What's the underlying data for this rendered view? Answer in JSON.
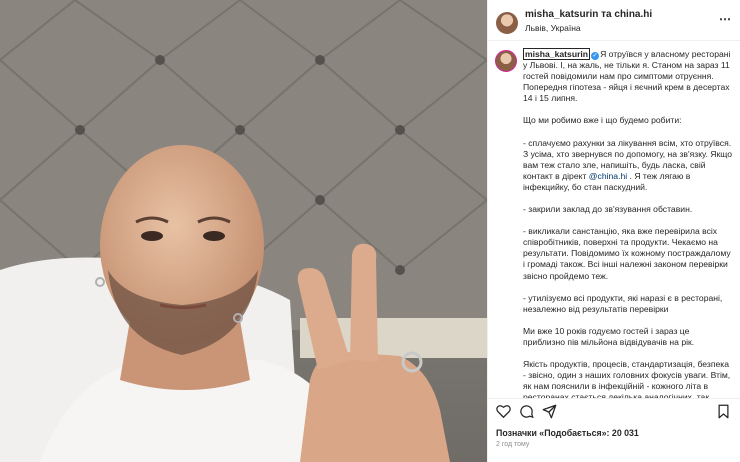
{
  "post": {
    "header": {
      "names": "misha_katsurin та china.hi",
      "location": "Львів, Україна",
      "more_icon": "⋯"
    },
    "caption": {
      "username": "misha_katsurin",
      "first_paragraph": "Я отруївся у власному ресторані у Львові. І, на жаль, не тільки я. Станом на зараз 11 гостей повідомили нам про симптоми отруєння. Попередня гіпотеза - яйця і яєчний крем в десертах 14 і 15 липня.",
      "intro": "Що ми робимо вже і що будемо робити:",
      "item1_before": "- сплачуємо рахунки за лікування всім, хто отруївся. З усіма, хто звернувся по допомогу, на зв'язку. Якщо вам теж стало зле, напишіть, будь ласка, свій контакт в дірект ",
      "item1_mention": "@china.hi",
      "item1_after": " . Я теж лягаю в інфекцийку, бо стан паскудний.",
      "item2": "- закрили заклад до зв'язування обставин.",
      "item3": "- викликали санстанцію, яка вже перевірила всіх співробітників, поверхні та продукти. Чекаємо на результати. Повідомимо їх кожному постраждалому і громаді також. Всі інші належні законом перевірки звісно пройдемо теж.",
      "item4": "- утилізуємо всі продукти, які наразі є в ресторані, незалежно від результатів перевірки",
      "para_guests": "Ми вже 10 років годуємо гостей і зараз це приблизно пів мільйона відвідувачів на рік.",
      "para_quality": "Якість продуктів, процесів, стандартизація, безпека - звісно, один з наших головних фокусів уваги. Втім, як нам пояснили в інфекційній - кожного літа в ресторанах стається декілька аналогічних, так званих «спалахів». На жаль, цього разу «спалах» стався з нами."
    },
    "likes_text": "Позначки «Подобається»: 20 031",
    "time_text": "2 год тому"
  },
  "colors": {
    "accent_link": "#00376b",
    "verified": "#3897f0",
    "muted": "#8e8e8e"
  }
}
